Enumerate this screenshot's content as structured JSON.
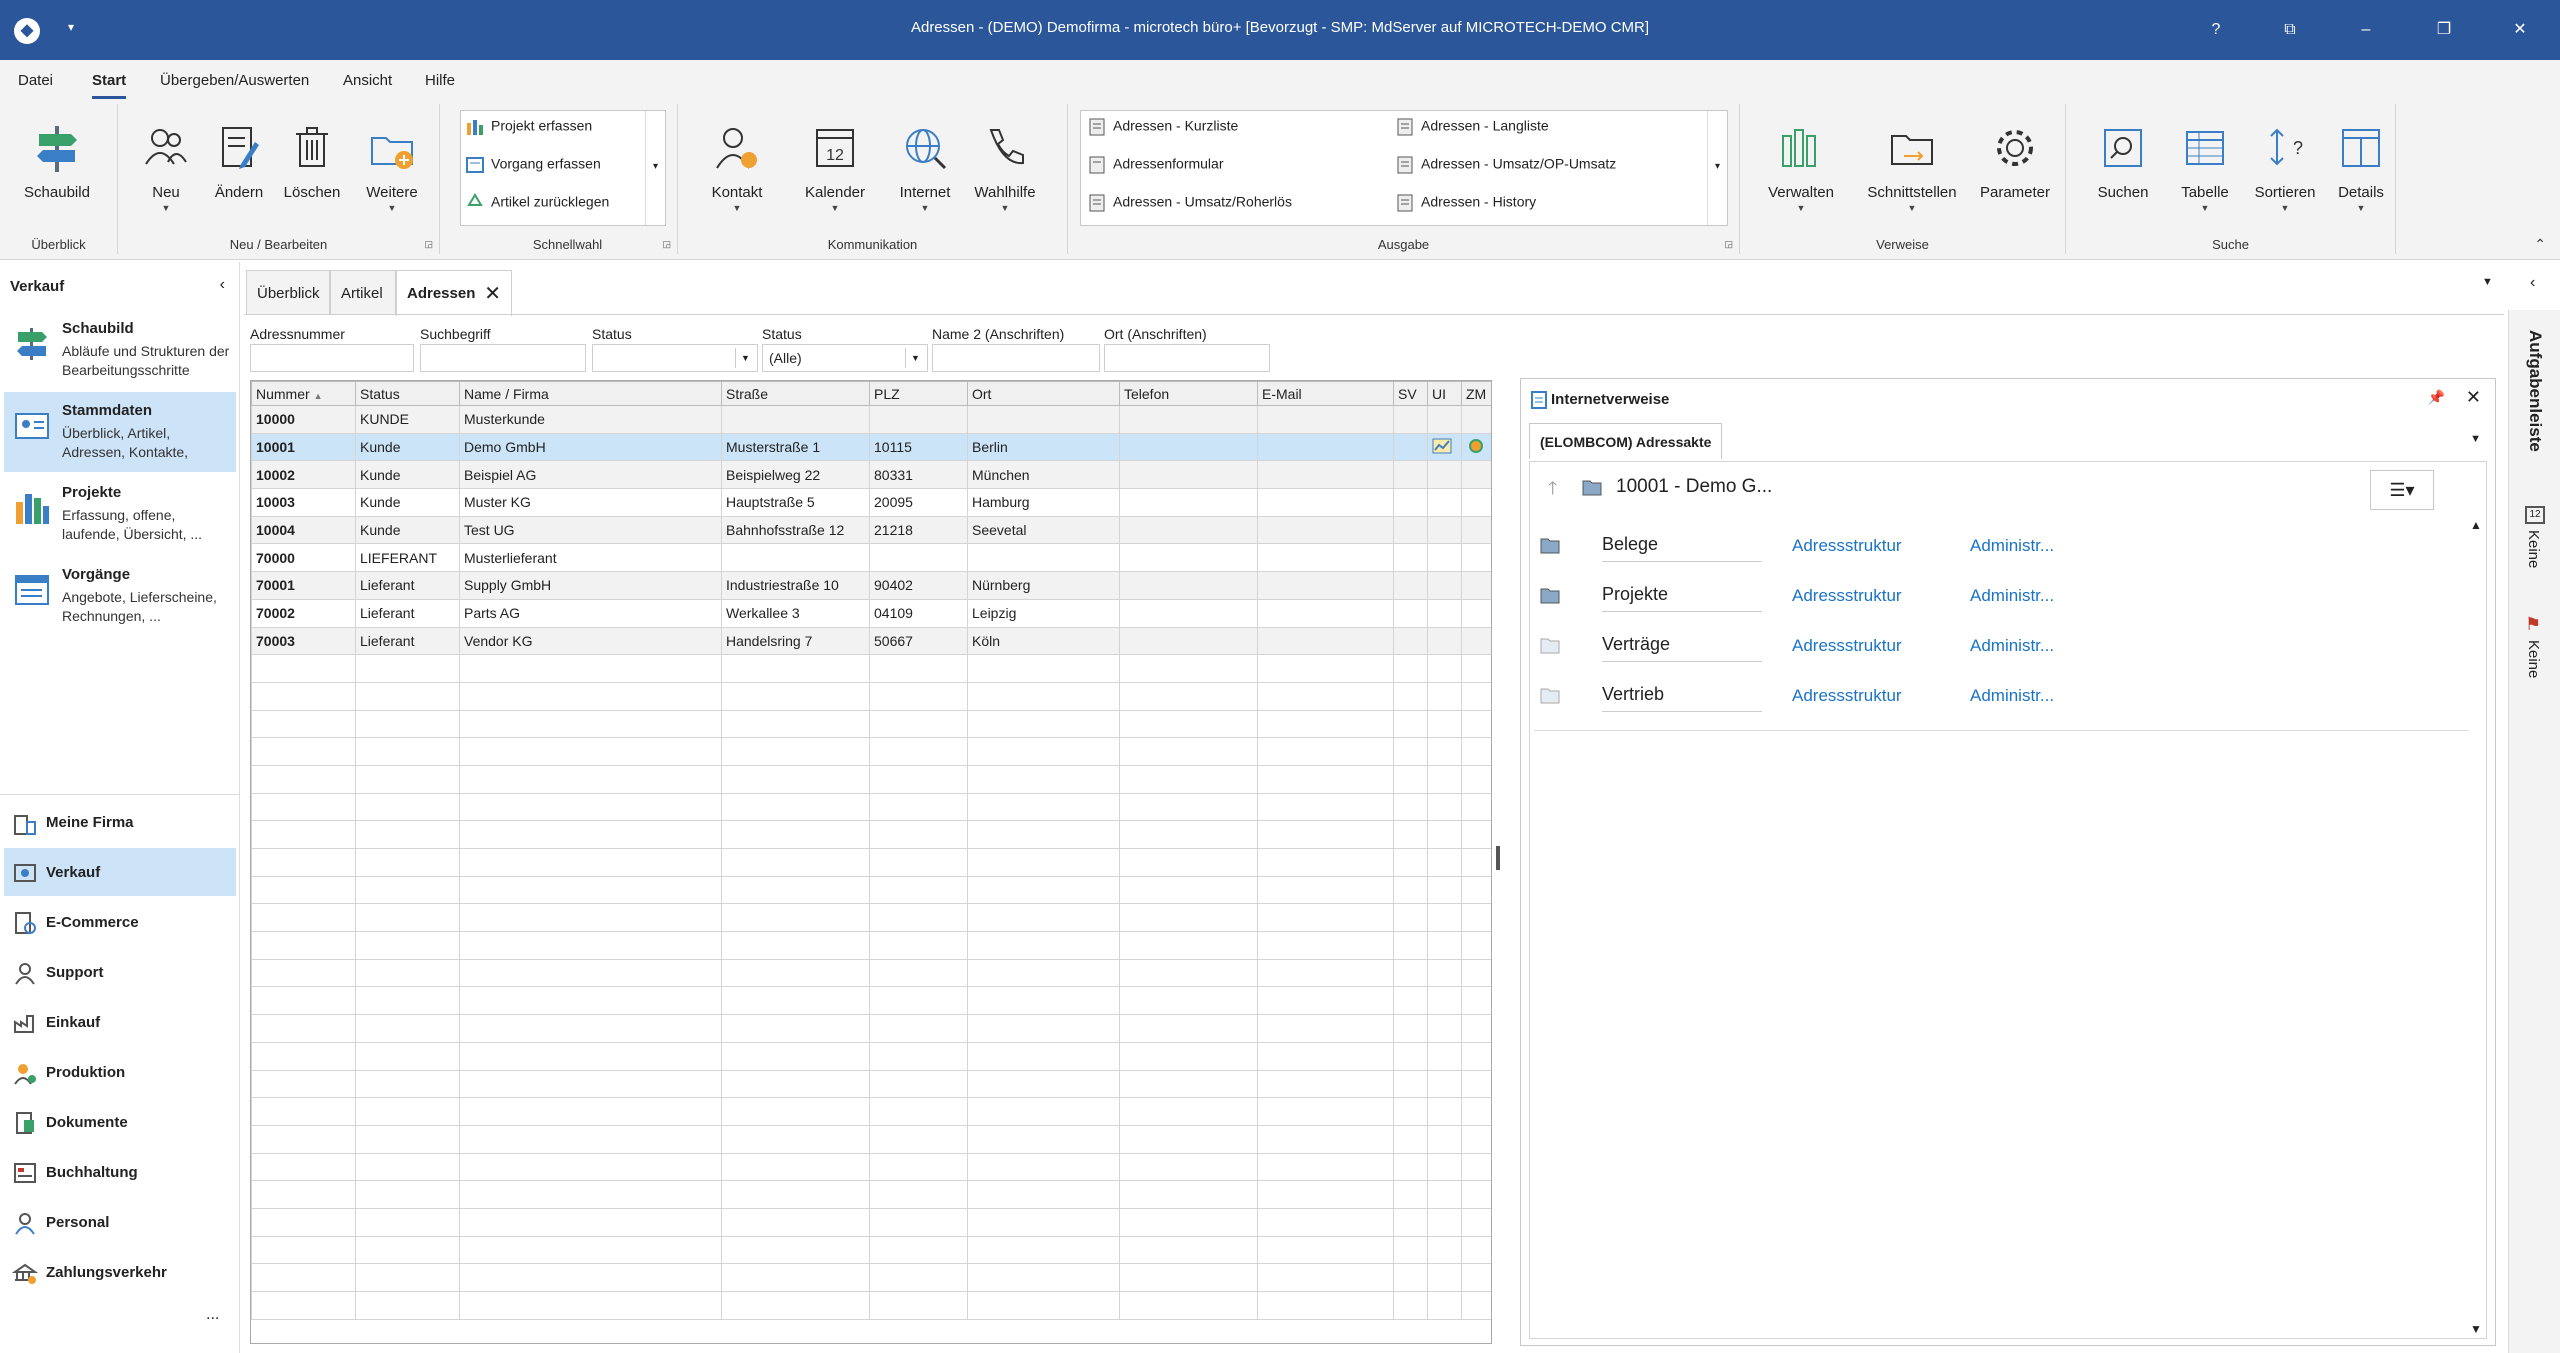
{
  "window": {
    "title": "Adressen - (DEMO) Demofirma - microtech büro+ [Bevorzugt - SMP: MdServer auf MICROTECH-DEMO CMR]",
    "help": "?",
    "restore": "⧉",
    "minimize": "–",
    "maximize": "❐",
    "close": "✕",
    "quick_access": "▾"
  },
  "menu": [
    "Datei",
    "Start",
    "Übergeben/Auswerten",
    "Ansicht",
    "Hilfe"
  ],
  "ribbon": {
    "groups": {
      "ueberblick": "Überblick",
      "neu": "Neu / Bearbeiten",
      "schnellwahl": "Schnellwahl",
      "kommunikation": "Kommunikation",
      "ausgabe": "Ausgabe",
      "verweise": "Verweise",
      "suche": "Suche"
    },
    "schaubild": "Schaubild",
    "neu_buttons": [
      "Neu",
      "Ändern",
      "Löschen",
      "Weitere"
    ],
    "schnellwahl_items": [
      "Projekt erfassen",
      "Vorgang erfassen",
      "Artikel zurücklegen"
    ],
    "kommunikation_buttons": [
      "Kontakt",
      "Kalender",
      "Internet",
      "Wahlhilfe"
    ],
    "ausgabe_items": [
      "Adressen - Kurzliste",
      "Adressenformular",
      "Adressen - Umsatz/Roherlös",
      "Adressen - Langliste",
      "Adressen - Umsatz/OP-Umsatz",
      "Adressen - History"
    ],
    "verweise_buttons": [
      "Verwalten",
      "Schnittstellen",
      "Parameter"
    ],
    "suche_buttons": [
      "Suchen",
      "Tabelle",
      "Sortieren",
      "Details"
    ]
  },
  "leftnav": {
    "header": "Verkauf",
    "items": [
      {
        "title": "Schaubild",
        "desc": "Abläufe und Strukturen der Bearbeitungsschritte"
      },
      {
        "title": "Stammdaten",
        "desc": "Überblick, Artikel, Adressen, Kontakte,"
      },
      {
        "title": "Projekte",
        "desc": "Erfassung, offene, laufende, Übersicht, ..."
      },
      {
        "title": "Vorgänge",
        "desc": "Angebote, Lieferscheine, Rechnungen, ..."
      }
    ],
    "modules": [
      "Meine Firma",
      "Verkauf",
      "E-Commerce",
      "Support",
      "Einkauf",
      "Produktion",
      "Dokumente",
      "Buchhaltung",
      "Personal",
      "Zahlungsverkehr"
    ],
    "more": "..."
  },
  "tabs": [
    "Überblick",
    "Artikel",
    "Adressen"
  ],
  "filters": {
    "labels": [
      "Adressnummer",
      "Suchbegriff",
      "Status",
      "Status",
      "Name 2 (Anschriften)",
      "Ort (Anschriften)"
    ],
    "status2_value": "(Alle)"
  },
  "grid": {
    "columns": [
      "Nummer",
      "Status",
      "Name / Firma",
      "Straße",
      "PLZ",
      "Ort",
      "Telefon",
      "E-Mail",
      "SV",
      "UI",
      "ZM"
    ],
    "rows": [
      [
        "10000",
        "KUNDE",
        "Musterkunde",
        "",
        "",
        ""
      ],
      [
        "10001",
        "Kunde",
        "Demo GmbH",
        "Musterstraße 1",
        "10115",
        "Berlin"
      ],
      [
        "10002",
        "Kunde",
        "Beispiel AG",
        "Beispielweg 22",
        "80331",
        "München"
      ],
      [
        "10003",
        "Kunde",
        "Muster KG",
        "Hauptstraße 5",
        "20095",
        "Hamburg"
      ],
      [
        "10004",
        "Kunde",
        "Test UG",
        "Bahnhofsstraße 12",
        "21218",
        "Seevetal"
      ],
      [
        "70000",
        "LIEFERANT",
        "Musterlieferant",
        "",
        "",
        ""
      ],
      [
        "70001",
        "Lieferant",
        "Supply GmbH",
        "Industriestraße 10",
        "90402",
        "Nürnberg"
      ],
      [
        "70002",
        "Lieferant",
        "Parts AG",
        "Werkallee 3",
        "04109",
        "Leipzig"
      ],
      [
        "70003",
        "Lieferant",
        "Vendor KG",
        "Handelsring 7",
        "50667",
        "Köln"
      ]
    ]
  },
  "rightpanel": {
    "title": "Internetverweise",
    "tab": "(ELOMBCOM) Adressakte",
    "path": "10001 - Demo G...",
    "menu_icon": "☰▾",
    "rows": [
      {
        "name": "Belege",
        "link1": "Adressstruktur",
        "link2": "Administr..."
      },
      {
        "name": "Projekte",
        "link1": "Adressstruktur",
        "link2": "Administr..."
      },
      {
        "name": "Verträge",
        "link1": "Adressstruktur",
        "link2": "Administr..."
      },
      {
        "name": "Vertrieb",
        "link1": "Adressstruktur",
        "link2": "Administr..."
      }
    ]
  },
  "taskbar": {
    "title": "Aufgabenleiste",
    "item1": "Keine",
    "item2": "Keine"
  },
  "colors": {
    "accent": "#2b579a",
    "selection": "#cde3f7",
    "link": "#1a73c6"
  }
}
